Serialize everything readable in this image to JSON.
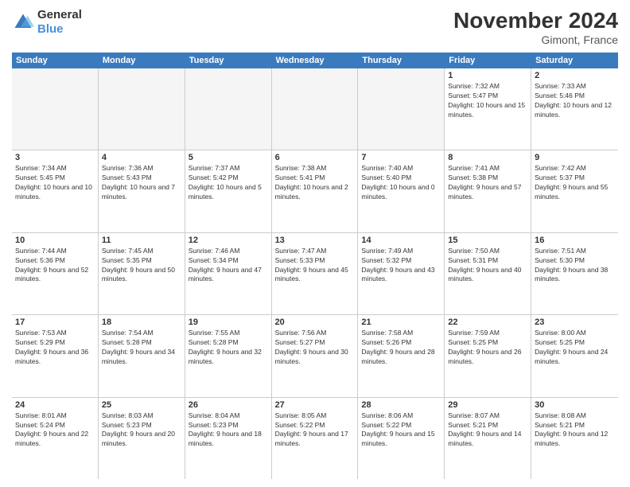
{
  "logo": {
    "text_general": "General",
    "text_blue": "Blue"
  },
  "title": "November 2024",
  "location": "Gimont, France",
  "days_header": [
    "Sunday",
    "Monday",
    "Tuesday",
    "Wednesday",
    "Thursday",
    "Friday",
    "Saturday"
  ],
  "weeks": [
    [
      {
        "day": "",
        "info": "",
        "empty": true
      },
      {
        "day": "",
        "info": "",
        "empty": true
      },
      {
        "day": "",
        "info": "",
        "empty": true
      },
      {
        "day": "",
        "info": "",
        "empty": true
      },
      {
        "day": "",
        "info": "",
        "empty": true
      },
      {
        "day": "1",
        "info": "Sunrise: 7:32 AM\nSunset: 5:47 PM\nDaylight: 10 hours and 15 minutes.",
        "empty": false
      },
      {
        "day": "2",
        "info": "Sunrise: 7:33 AM\nSunset: 5:46 PM\nDaylight: 10 hours and 12 minutes.",
        "empty": false
      }
    ],
    [
      {
        "day": "3",
        "info": "Sunrise: 7:34 AM\nSunset: 5:45 PM\nDaylight: 10 hours and 10 minutes.",
        "empty": false
      },
      {
        "day": "4",
        "info": "Sunrise: 7:36 AM\nSunset: 5:43 PM\nDaylight: 10 hours and 7 minutes.",
        "empty": false
      },
      {
        "day": "5",
        "info": "Sunrise: 7:37 AM\nSunset: 5:42 PM\nDaylight: 10 hours and 5 minutes.",
        "empty": false
      },
      {
        "day": "6",
        "info": "Sunrise: 7:38 AM\nSunset: 5:41 PM\nDaylight: 10 hours and 2 minutes.",
        "empty": false
      },
      {
        "day": "7",
        "info": "Sunrise: 7:40 AM\nSunset: 5:40 PM\nDaylight: 10 hours and 0 minutes.",
        "empty": false
      },
      {
        "day": "8",
        "info": "Sunrise: 7:41 AM\nSunset: 5:38 PM\nDaylight: 9 hours and 57 minutes.",
        "empty": false
      },
      {
        "day": "9",
        "info": "Sunrise: 7:42 AM\nSunset: 5:37 PM\nDaylight: 9 hours and 55 minutes.",
        "empty": false
      }
    ],
    [
      {
        "day": "10",
        "info": "Sunrise: 7:44 AM\nSunset: 5:36 PM\nDaylight: 9 hours and 52 minutes.",
        "empty": false
      },
      {
        "day": "11",
        "info": "Sunrise: 7:45 AM\nSunset: 5:35 PM\nDaylight: 9 hours and 50 minutes.",
        "empty": false
      },
      {
        "day": "12",
        "info": "Sunrise: 7:46 AM\nSunset: 5:34 PM\nDaylight: 9 hours and 47 minutes.",
        "empty": false
      },
      {
        "day": "13",
        "info": "Sunrise: 7:47 AM\nSunset: 5:33 PM\nDaylight: 9 hours and 45 minutes.",
        "empty": false
      },
      {
        "day": "14",
        "info": "Sunrise: 7:49 AM\nSunset: 5:32 PM\nDaylight: 9 hours and 43 minutes.",
        "empty": false
      },
      {
        "day": "15",
        "info": "Sunrise: 7:50 AM\nSunset: 5:31 PM\nDaylight: 9 hours and 40 minutes.",
        "empty": false
      },
      {
        "day": "16",
        "info": "Sunrise: 7:51 AM\nSunset: 5:30 PM\nDaylight: 9 hours and 38 minutes.",
        "empty": false
      }
    ],
    [
      {
        "day": "17",
        "info": "Sunrise: 7:53 AM\nSunset: 5:29 PM\nDaylight: 9 hours and 36 minutes.",
        "empty": false
      },
      {
        "day": "18",
        "info": "Sunrise: 7:54 AM\nSunset: 5:28 PM\nDaylight: 9 hours and 34 minutes.",
        "empty": false
      },
      {
        "day": "19",
        "info": "Sunrise: 7:55 AM\nSunset: 5:28 PM\nDaylight: 9 hours and 32 minutes.",
        "empty": false
      },
      {
        "day": "20",
        "info": "Sunrise: 7:56 AM\nSunset: 5:27 PM\nDaylight: 9 hours and 30 minutes.",
        "empty": false
      },
      {
        "day": "21",
        "info": "Sunrise: 7:58 AM\nSunset: 5:26 PM\nDaylight: 9 hours and 28 minutes.",
        "empty": false
      },
      {
        "day": "22",
        "info": "Sunrise: 7:59 AM\nSunset: 5:25 PM\nDaylight: 9 hours and 26 minutes.",
        "empty": false
      },
      {
        "day": "23",
        "info": "Sunrise: 8:00 AM\nSunset: 5:25 PM\nDaylight: 9 hours and 24 minutes.",
        "empty": false
      }
    ],
    [
      {
        "day": "24",
        "info": "Sunrise: 8:01 AM\nSunset: 5:24 PM\nDaylight: 9 hours and 22 minutes.",
        "empty": false
      },
      {
        "day": "25",
        "info": "Sunrise: 8:03 AM\nSunset: 5:23 PM\nDaylight: 9 hours and 20 minutes.",
        "empty": false
      },
      {
        "day": "26",
        "info": "Sunrise: 8:04 AM\nSunset: 5:23 PM\nDaylight: 9 hours and 18 minutes.",
        "empty": false
      },
      {
        "day": "27",
        "info": "Sunrise: 8:05 AM\nSunset: 5:22 PM\nDaylight: 9 hours and 17 minutes.",
        "empty": false
      },
      {
        "day": "28",
        "info": "Sunrise: 8:06 AM\nSunset: 5:22 PM\nDaylight: 9 hours and 15 minutes.",
        "empty": false
      },
      {
        "day": "29",
        "info": "Sunrise: 8:07 AM\nSunset: 5:21 PM\nDaylight: 9 hours and 14 minutes.",
        "empty": false
      },
      {
        "day": "30",
        "info": "Sunrise: 8:08 AM\nSunset: 5:21 PM\nDaylight: 9 hours and 12 minutes.",
        "empty": false
      }
    ]
  ]
}
